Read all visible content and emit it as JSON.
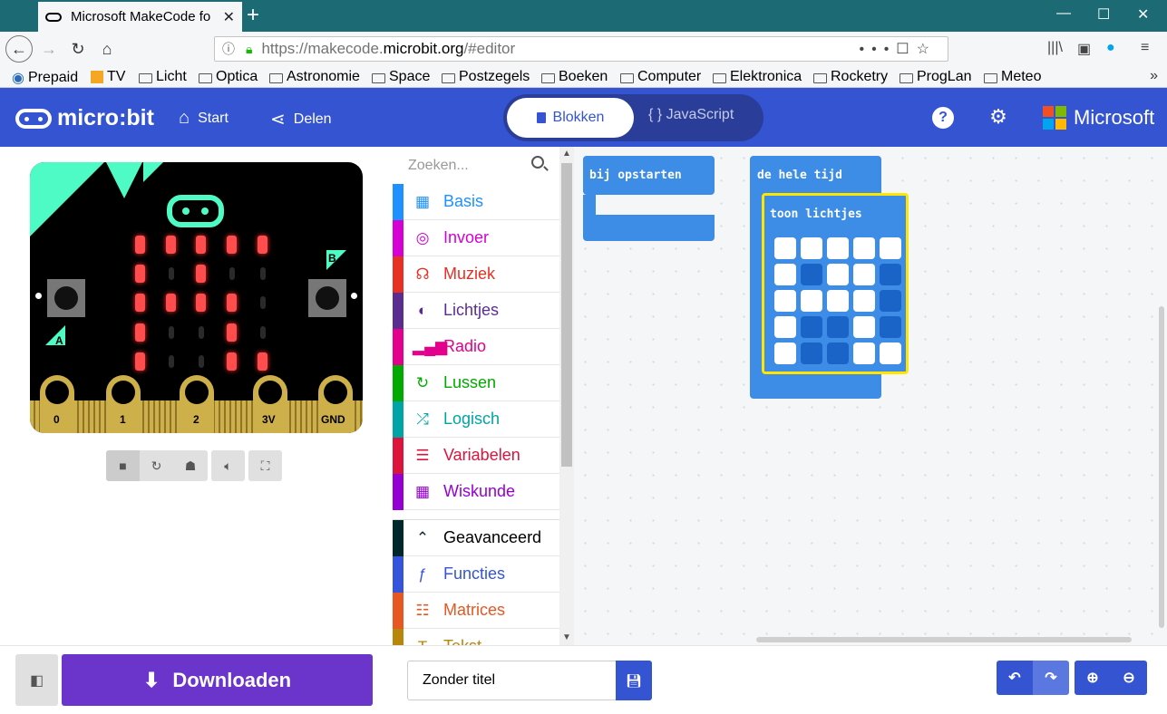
{
  "browser": {
    "tab_title": "Microsoft MakeCode fo",
    "url_prefix": "https://makecode.",
    "url_host": "microbit.org",
    "url_suffix": "/#editor",
    "bookmarks": [
      "Prepaid",
      "TV",
      "Licht",
      "Optica",
      "Astronomie",
      "Space",
      "Postzegels",
      "Boeken",
      "Computer",
      "Elektronica",
      "Rocketry",
      "ProgLan",
      "Meteo"
    ]
  },
  "header": {
    "logo": "micro:bit",
    "start": "Start",
    "share": "Delen",
    "blocks_tab": "Blokken",
    "js_tab": "{ } JavaScript",
    "brand": "Microsoft",
    "brand_colors": [
      "#f25022",
      "#7fba00",
      "#00a4ef",
      "#ffb900"
    ],
    "accent": "#3454d1"
  },
  "simulator": {
    "button_a": "A",
    "button_b": "B",
    "pins": [
      "0",
      "1",
      "2",
      "3V",
      "GND"
    ],
    "led_grid": [
      [
        1,
        1,
        1,
        1,
        1
      ],
      [
        1,
        0,
        1,
        0,
        0
      ],
      [
        1,
        1,
        1,
        1,
        0
      ],
      [
        1,
        0,
        0,
        1,
        0
      ],
      [
        1,
        0,
        0,
        1,
        1
      ]
    ]
  },
  "toolbox": {
    "search_placeholder": "Zoeken...",
    "categories": [
      {
        "label": "Basis",
        "color": "#1e90ff",
        "icon": "grid-icon"
      },
      {
        "label": "Invoer",
        "color": "#d400d4",
        "icon": "target-icon"
      },
      {
        "label": "Muziek",
        "color": "#e63022",
        "icon": "headphones-icon"
      },
      {
        "label": "Lichtjes",
        "color": "#5c2d91",
        "icon": "toggle-icon"
      },
      {
        "label": "Radio",
        "color": "#e3008c",
        "icon": "signal-icon"
      },
      {
        "label": "Lussen",
        "color": "#00aa00",
        "icon": "loop-icon"
      },
      {
        "label": "Logisch",
        "color": "#00a4a6",
        "icon": "shuffle-icon"
      },
      {
        "label": "Variabelen",
        "color": "#dc143c",
        "icon": "lines-icon"
      },
      {
        "label": "Wiskunde",
        "color": "#9400d3",
        "icon": "calculator-icon"
      }
    ],
    "advanced": [
      {
        "label": "Geavanceerd",
        "color": "#00272b",
        "text_color": "#000000",
        "icon": "chevron-up-icon"
      },
      {
        "label": "Functies",
        "color": "#3455db",
        "icon": "function-icon"
      },
      {
        "label": "Matrices",
        "color": "#e65722",
        "icon": "list-icon"
      },
      {
        "label": "Tekst",
        "color": "#b8860b",
        "icon": "text-icon"
      }
    ]
  },
  "workspace": {
    "on_start": "bij opstarten",
    "forever": "de hele tijd",
    "show_leds": "toon lichtjes",
    "show_leds_grid": [
      [
        1,
        1,
        1,
        1,
        1
      ],
      [
        1,
        0,
        1,
        1,
        0
      ],
      [
        1,
        1,
        1,
        1,
        0
      ],
      [
        1,
        0,
        0,
        1,
        0
      ],
      [
        1,
        0,
        0,
        1,
        1
      ]
    ]
  },
  "footer": {
    "download": "Downloaden",
    "project_name": "Zonder titel"
  }
}
